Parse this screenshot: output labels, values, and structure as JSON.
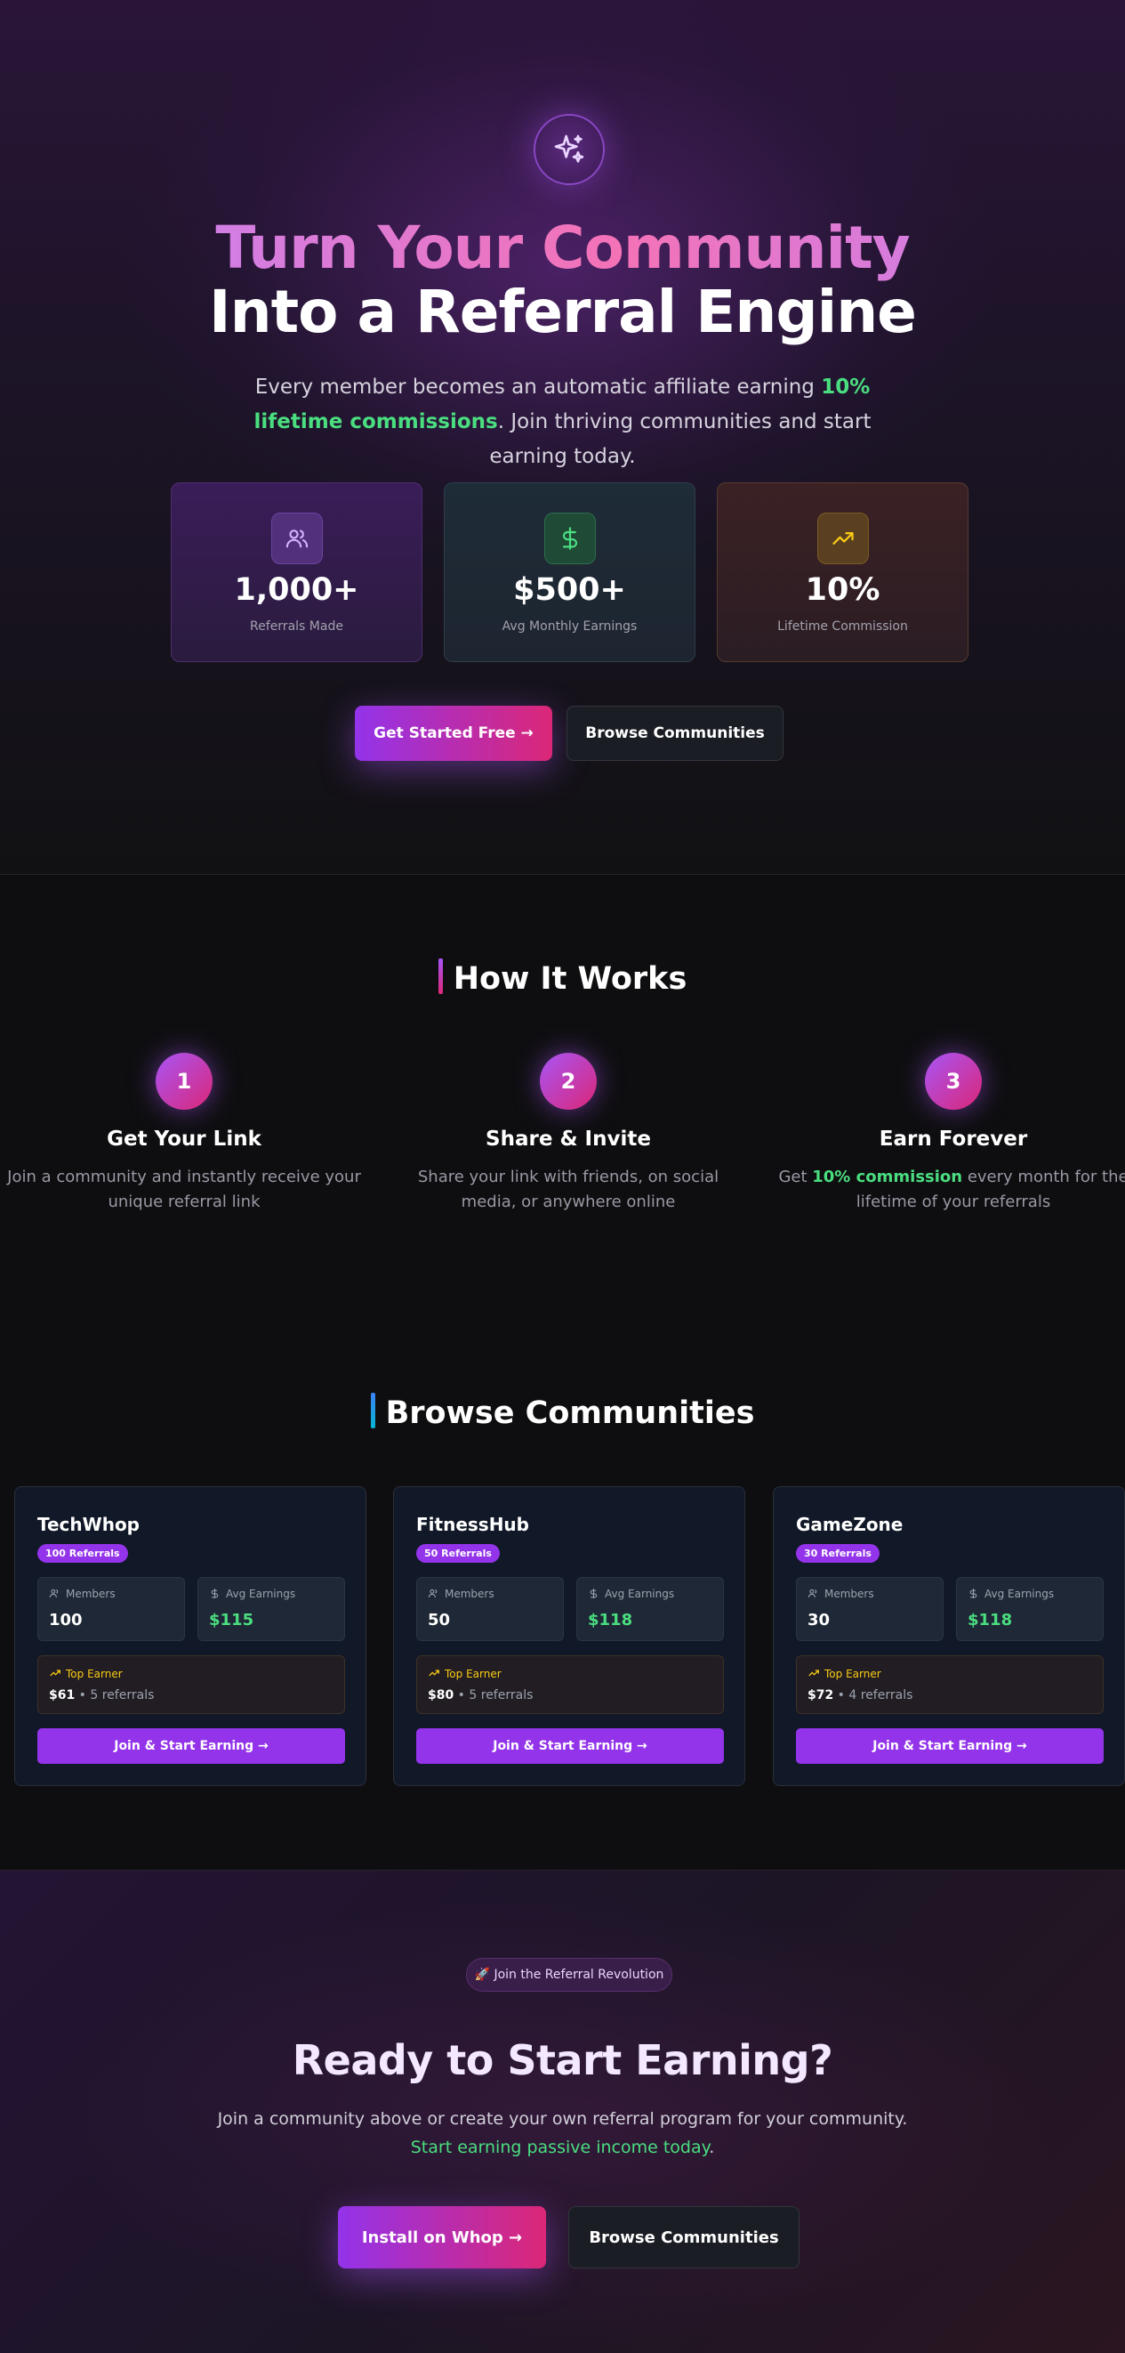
{
  "hero": {
    "title_line1": "Turn Your Community",
    "title_line2": "Into a Referral Engine",
    "subtitle_pre": "Every member becomes an automatic affiliate earning ",
    "subtitle_highlight": "10% lifetime commissions",
    "subtitle_post": ". Join thriving communities and start earning today.",
    "icon": "sparkles-icon"
  },
  "stats": [
    {
      "value": "1,000+",
      "label": "Referrals Made",
      "icon": "users-icon"
    },
    {
      "value": "$500+",
      "label": "Avg Monthly Earnings",
      "icon": "dollar-icon"
    },
    {
      "value": "10%",
      "label": "Lifetime Commission",
      "icon": "trending-up-icon"
    }
  ],
  "hero_buttons": {
    "primary": "Get Started Free →",
    "secondary": "Browse Communities"
  },
  "how": {
    "title": "How It Works",
    "steps": [
      {
        "num": "1",
        "title": "Get Your Link",
        "desc": "Join a community and instantly receive your unique referral link"
      },
      {
        "num": "2",
        "title": "Share & Invite",
        "desc": "Share your link with friends, on social media, or anywhere online"
      },
      {
        "num": "3",
        "title": "Earn Forever",
        "desc_pre": "Get ",
        "desc_highlight": "10% commission",
        "desc_post": " every month for the lifetime of your referrals"
      }
    ]
  },
  "browse": {
    "title": "Browse Communities",
    "members_label": "Members",
    "earnings_label": "Avg Earnings",
    "top_label": "Top Earner",
    "join_label": "Join & Start Earning →",
    "cards": [
      {
        "name": "TechWhop",
        "badge": "100 Referrals",
        "members": "100",
        "earnings": "$115",
        "top_amount": "$61",
        "top_refs": " • 5 referrals"
      },
      {
        "name": "FitnessHub",
        "badge": "50 Referrals",
        "members": "50",
        "earnings": "$118",
        "top_amount": "$80",
        "top_refs": " • 5 referrals"
      },
      {
        "name": "GameZone",
        "badge": "30 Referrals",
        "members": "30",
        "earnings": "$118",
        "top_amount": "$72",
        "top_refs": " • 4 referrals"
      }
    ]
  },
  "cta": {
    "pill": "🚀 Join the Referral Revolution",
    "title": "Ready to Start Earning?",
    "subtitle": "Join a community above or create your own referral program for your community.",
    "subtitle_green": "Start earning passive income today",
    "subtitle_green_tail": ".",
    "primary": "Install on Whop →",
    "secondary": "Browse Communities"
  },
  "colors": {
    "accent_purple": "#9333ea",
    "accent_pink": "#db2777",
    "green": "#4ade80",
    "gold": "#facc15"
  }
}
